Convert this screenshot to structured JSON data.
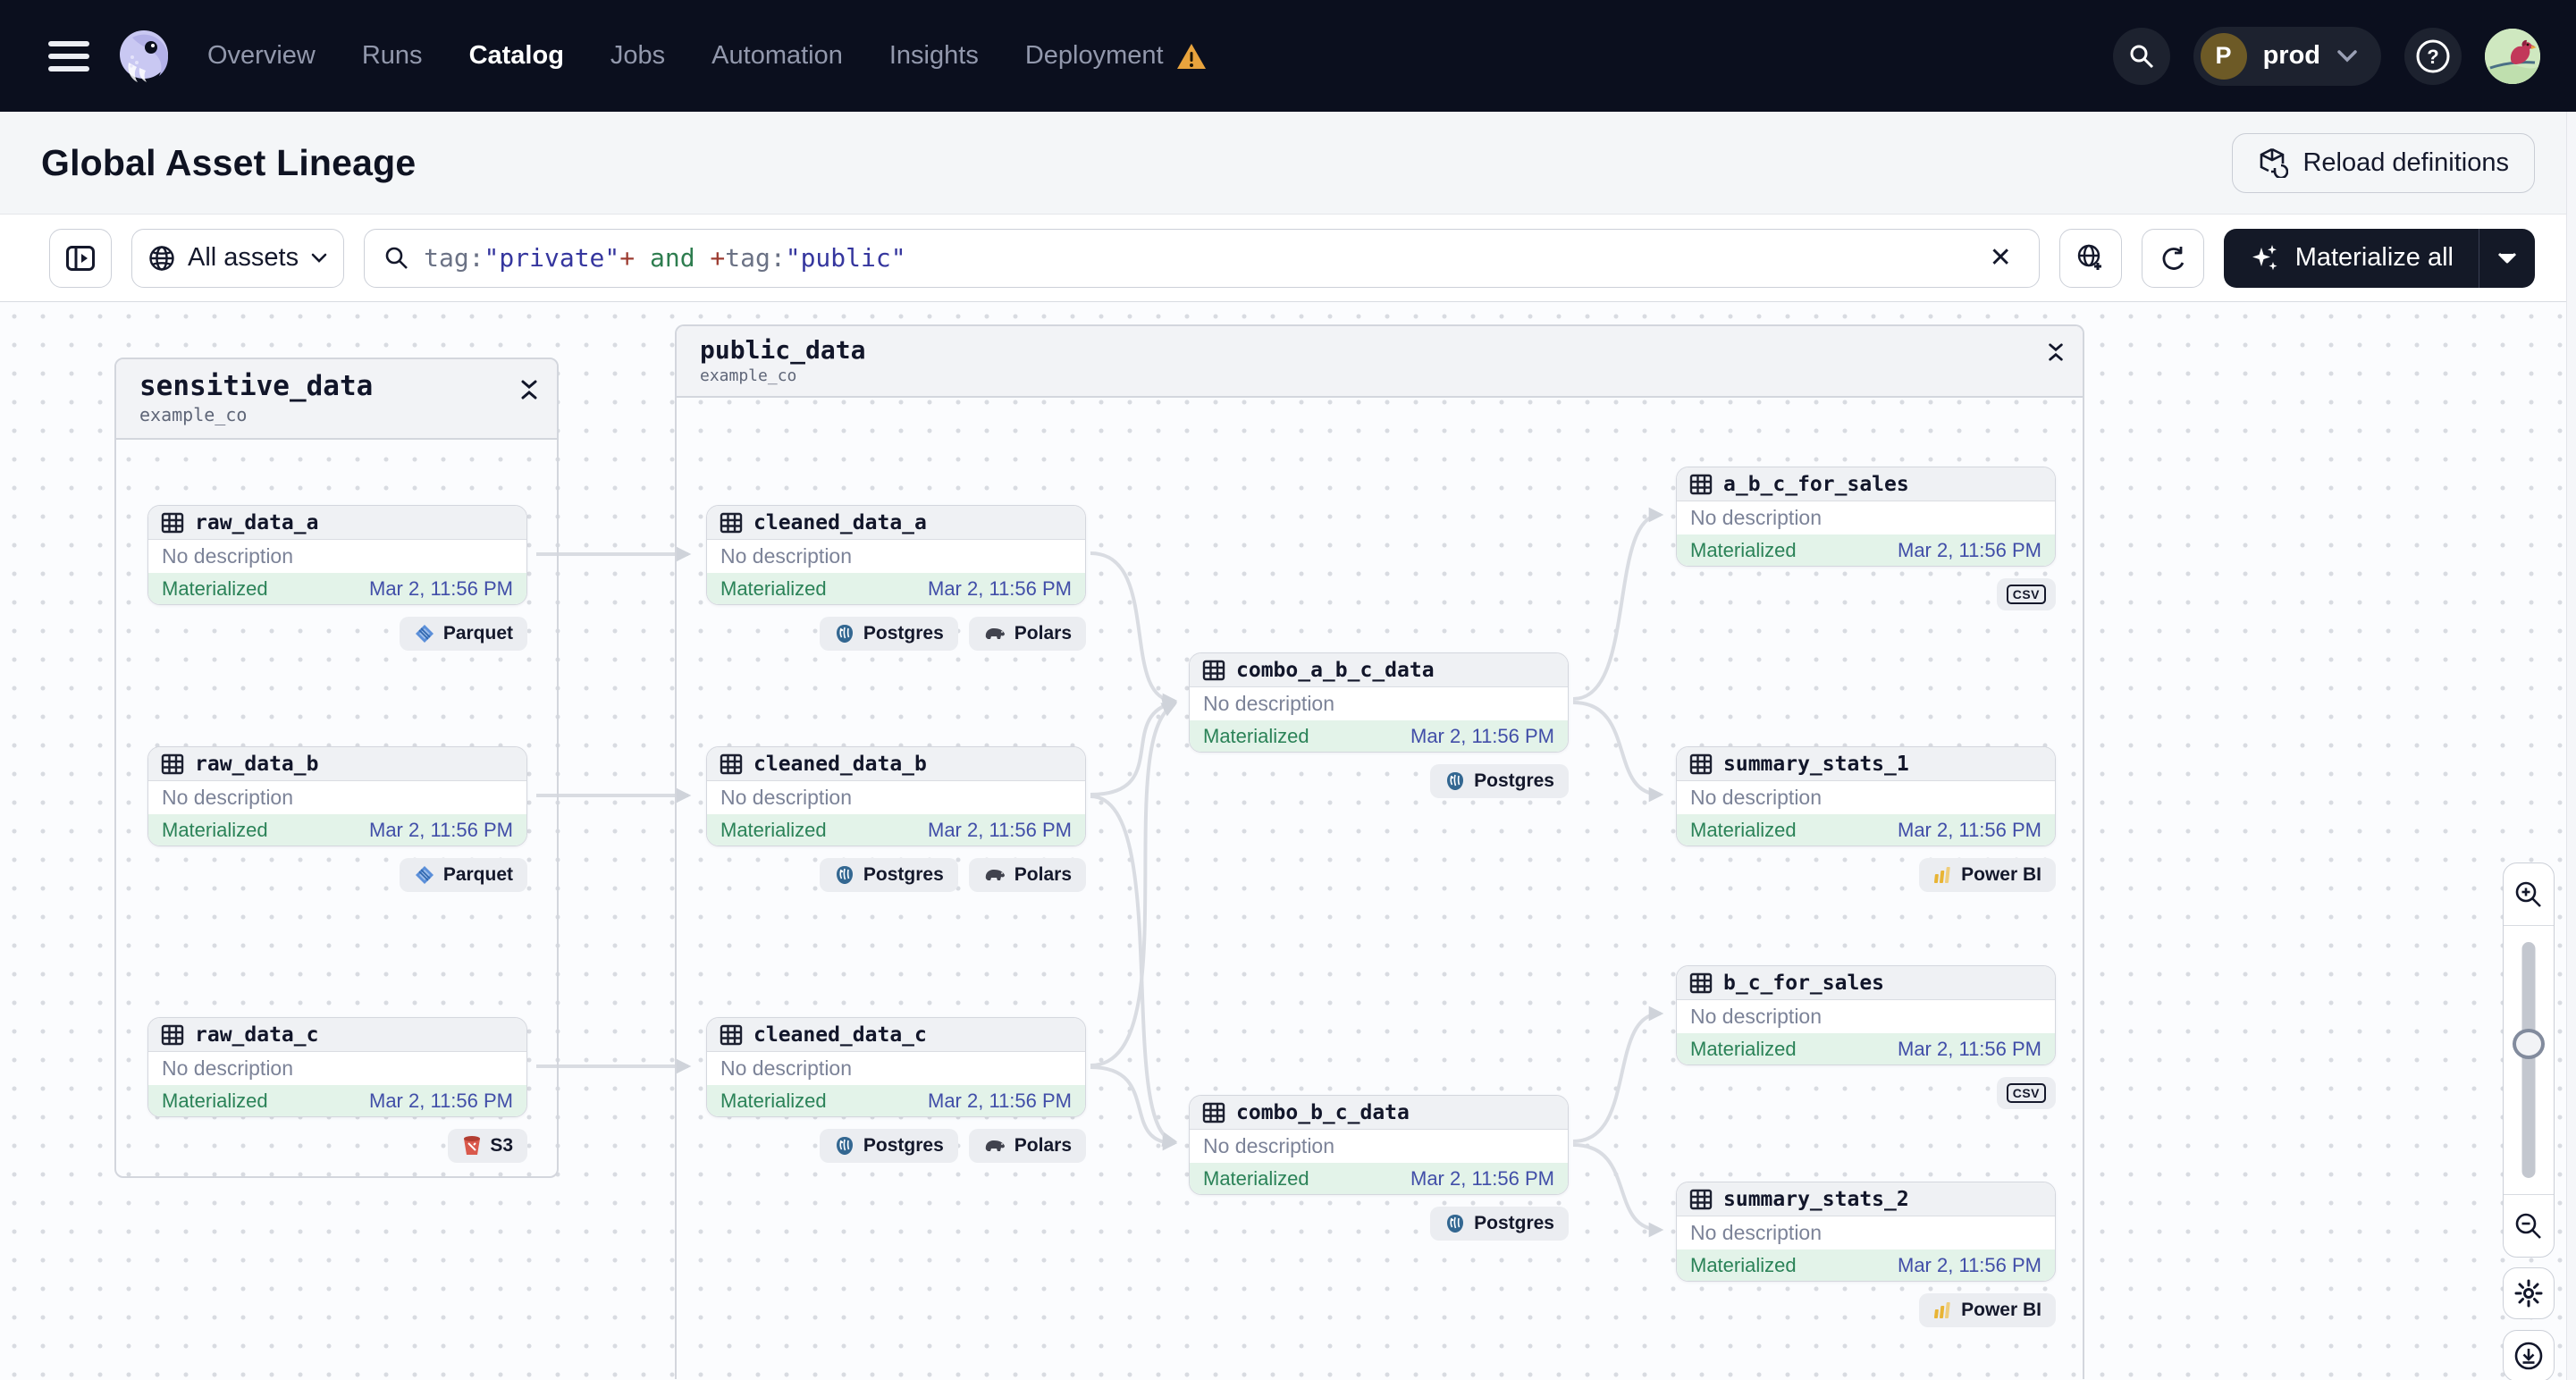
{
  "nav": {
    "items": [
      {
        "label": "Overview"
      },
      {
        "label": "Runs"
      },
      {
        "label": "Catalog",
        "active": true
      },
      {
        "label": "Jobs"
      },
      {
        "label": "Automation"
      },
      {
        "label": "Insights"
      },
      {
        "label": "Deployment",
        "warning": true
      }
    ],
    "environment": {
      "initial": "P",
      "name": "prod"
    }
  },
  "header": {
    "title": "Global Asset Lineage",
    "reload_label": "Reload definitions"
  },
  "toolbar": {
    "scope_label": "All assets",
    "query_segments": {
      "s0": "tag:",
      "s1": "\"private\"",
      "s2": "+",
      "s3": " and ",
      "s4": "+",
      "s5": "tag:",
      "s6": "\"public\""
    },
    "materialize_label": "Materialize all"
  },
  "groups": [
    {
      "name": "sensitive_data",
      "repo": "example_co"
    },
    {
      "name": "public_data",
      "repo": "example_co"
    }
  ],
  "node_common": {
    "description": "No description",
    "status": "Materialized",
    "date": "Mar 2, 11:56 PM"
  },
  "nodes": [
    {
      "name": "raw_data_a",
      "badges": [
        {
          "label": "Parquet"
        }
      ]
    },
    {
      "name": "raw_data_b",
      "badges": [
        {
          "label": "Parquet"
        }
      ]
    },
    {
      "name": "raw_data_c",
      "badges": [
        {
          "label": "S3"
        }
      ]
    },
    {
      "name": "cleaned_data_a",
      "badges": [
        {
          "label": "Postgres"
        },
        {
          "label": "Polars"
        }
      ]
    },
    {
      "name": "cleaned_data_b",
      "badges": [
        {
          "label": "Postgres"
        },
        {
          "label": "Polars"
        }
      ]
    },
    {
      "name": "cleaned_data_c",
      "badges": [
        {
          "label": "Postgres"
        },
        {
          "label": "Polars"
        }
      ]
    },
    {
      "name": "combo_a_b_c_data",
      "badges": [
        {
          "label": "Postgres"
        }
      ]
    },
    {
      "name": "combo_b_c_data",
      "badges": [
        {
          "label": "Postgres"
        }
      ]
    },
    {
      "name": "a_b_c_for_sales",
      "badges": [
        {
          "label": "CSV"
        }
      ]
    },
    {
      "name": "summary_stats_1",
      "badges": [
        {
          "label": "Power BI"
        }
      ]
    },
    {
      "name": "b_c_for_sales",
      "badges": [
        {
          "label": "CSV"
        }
      ]
    },
    {
      "name": "summary_stats_2",
      "badges": [
        {
          "label": "Power BI"
        }
      ]
    }
  ],
  "colors": {
    "nav_bg": "#0b0f1e",
    "accent_dark": "#141927",
    "materialized_green": "#2a8257",
    "materialized_bg": "#e3f3e9",
    "date_indigo": "#414ea8",
    "edge_gray": "#d9dce2",
    "warning_orange": "#e8a33d",
    "postgres_blue": "#336791",
    "s3_red": "#d9594c",
    "powerbi_yellow": "#e8b434",
    "parquet_blue": "#5b8fd9"
  }
}
